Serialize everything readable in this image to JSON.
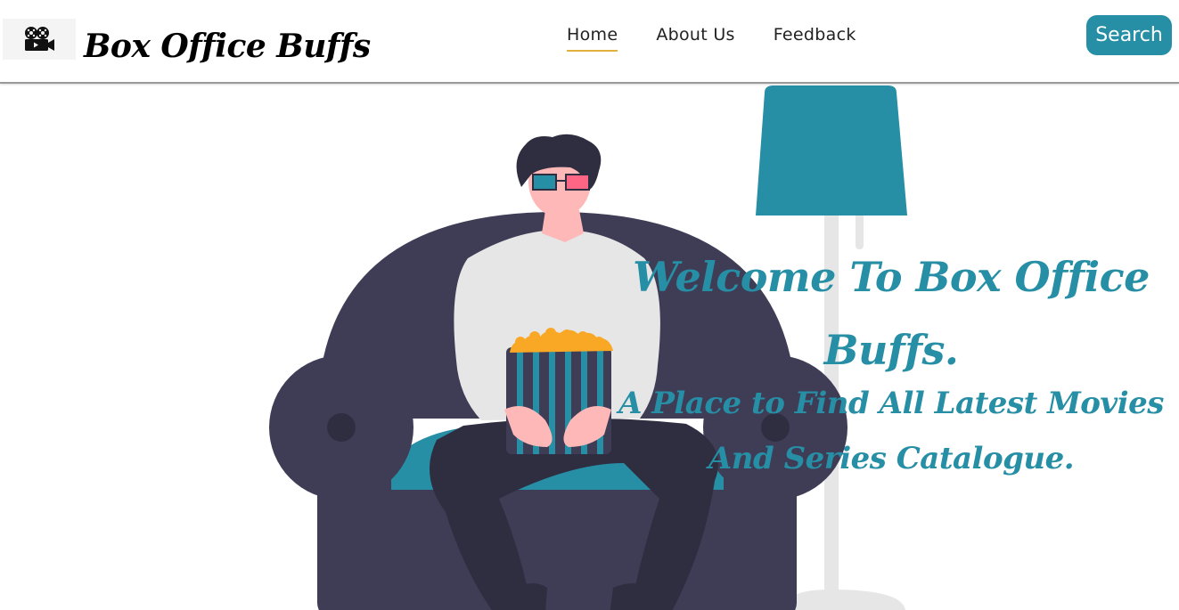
{
  "brand": {
    "name": "Box Office Buffs",
    "logo_icon": "film-camera-icon"
  },
  "nav": {
    "items": [
      {
        "label": "Home",
        "active": true
      },
      {
        "label": "About Us",
        "active": false
      },
      {
        "label": "Feedback",
        "active": false
      }
    ],
    "search_label": "Search"
  },
  "hero": {
    "heading": "Welcome To Box Office Buffs.",
    "tagline": "A Place to Find All Latest Movies And Series Catalogue.",
    "illustration": "person-on-couch-with-popcorn-illustration"
  },
  "colors": {
    "accent": "#268ea5",
    "nav_underline": "#e2b13c",
    "couch": "#3f3d56",
    "popcorn": "#f9a826",
    "glasses_right": "#ff6584"
  }
}
